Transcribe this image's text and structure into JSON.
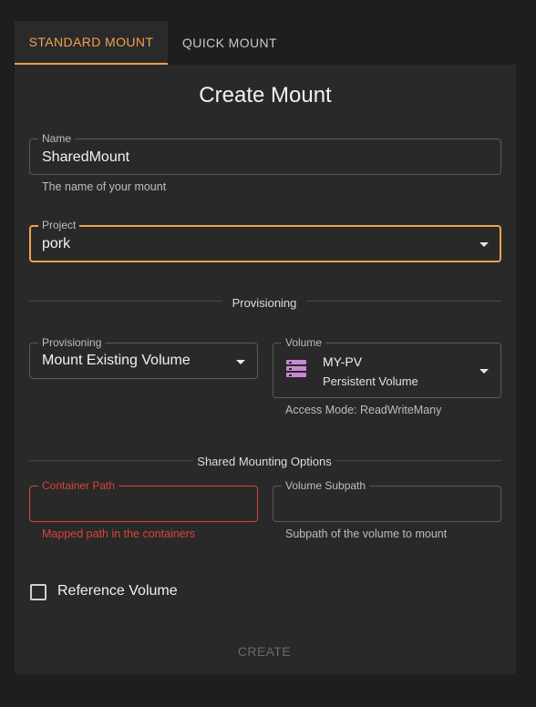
{
  "tabs": {
    "standard": "STANDARD MOUNT",
    "quick": "QUICK MOUNT"
  },
  "form": {
    "title": "Create Mount",
    "name": {
      "label": "Name",
      "value": "SharedMount",
      "helper": "The name of your mount"
    },
    "project": {
      "label": "Project",
      "value": "pork"
    },
    "provisioning_section": "Provisioning",
    "provisioning": {
      "label": "Provisioning",
      "value": "Mount Existing Volume"
    },
    "volume": {
      "label": "Volume",
      "name": "MY-PV",
      "type": "Persistent Volume",
      "helper": "Access Mode: ReadWriteMany"
    },
    "shared_section": "Shared Mounting Options",
    "container_path": {
      "label": "Container Path",
      "value": "",
      "helper": "Mapped path in the containers"
    },
    "volume_subpath": {
      "label": "Volume Subpath",
      "value": "",
      "helper": "Subpath of the volume to mount"
    },
    "reference_volume": {
      "label": "Reference Volume",
      "checked": false
    },
    "create_button": "CREATE"
  },
  "colors": {
    "accent": "#f0a050",
    "error": "#d9443a",
    "volume_icon": "#c987d6"
  },
  "icons": {
    "dropdown": "caret-down-icon",
    "volume": "server-stack-icon"
  }
}
